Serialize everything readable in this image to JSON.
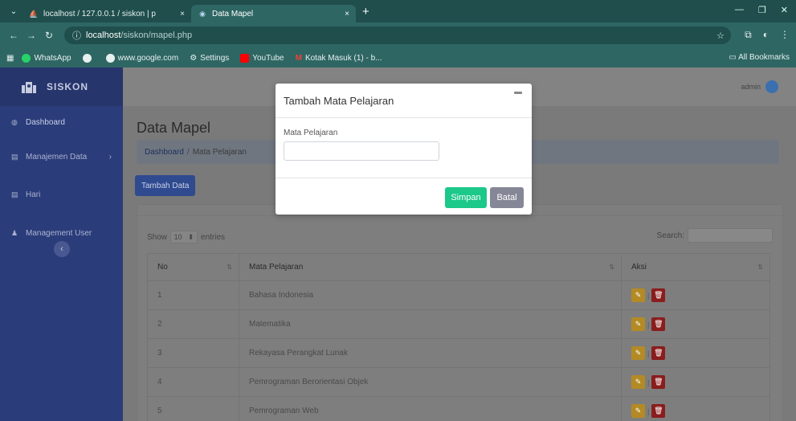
{
  "browser": {
    "tabs": [
      {
        "title": "localhost / 127.0.0.1 / siskon | p",
        "close": "×"
      },
      {
        "title": "Data Mapel",
        "close": "×"
      }
    ],
    "url_host": "localhost",
    "url_path": "/siskon/mapel.php",
    "bookmarks": [
      "WhatsApp",
      "www.google.com",
      "Settings",
      "YouTube",
      "Kotak Masuk (1) - b..."
    ],
    "all_bookmarks": "All Bookmarks"
  },
  "sidebar": {
    "brand": "SISKON",
    "items": [
      {
        "label": "Dashboard",
        "icon": "palette-icon"
      },
      {
        "label": "Manajemen Data",
        "icon": "table-icon"
      },
      {
        "label": "Hari",
        "icon": "table-icon"
      },
      {
        "label": "Management User",
        "icon": "users-icon"
      }
    ]
  },
  "topbar": {
    "user": "admin"
  },
  "main": {
    "title": "Data Mapel",
    "breadcrumb": {
      "home": "Dashboard",
      "sep": "/",
      "current": "Mata Pelajaran"
    },
    "add_button": "Tambah Data",
    "length": {
      "show": "Show",
      "value": "10",
      "entries": "entries"
    },
    "search_label": "Search:",
    "columns": [
      "No",
      "Mata Pelajaran",
      "Aksi"
    ],
    "rows": [
      {
        "no": "1",
        "mapel": "Bahasa Indonesia"
      },
      {
        "no": "2",
        "mapel": "Matematika"
      },
      {
        "no": "3",
        "mapel": "Rekayasa Perangkat Lunak"
      },
      {
        "no": "4",
        "mapel": "Pemrograman Berorientasi Objek"
      },
      {
        "no": "5",
        "mapel": "Pemrograman Web"
      }
    ]
  },
  "modal": {
    "title": "Tambah Mata Pelajaran",
    "field_label": "Mata Pelajaran",
    "field_value": "",
    "save": "Simpan",
    "cancel": "Batal"
  },
  "colors": {
    "sidebar": "#2b3c7a",
    "save": "#1cc88a",
    "cancel": "#858796",
    "edit": "#b38a24",
    "delete": "#8a1d1d"
  }
}
